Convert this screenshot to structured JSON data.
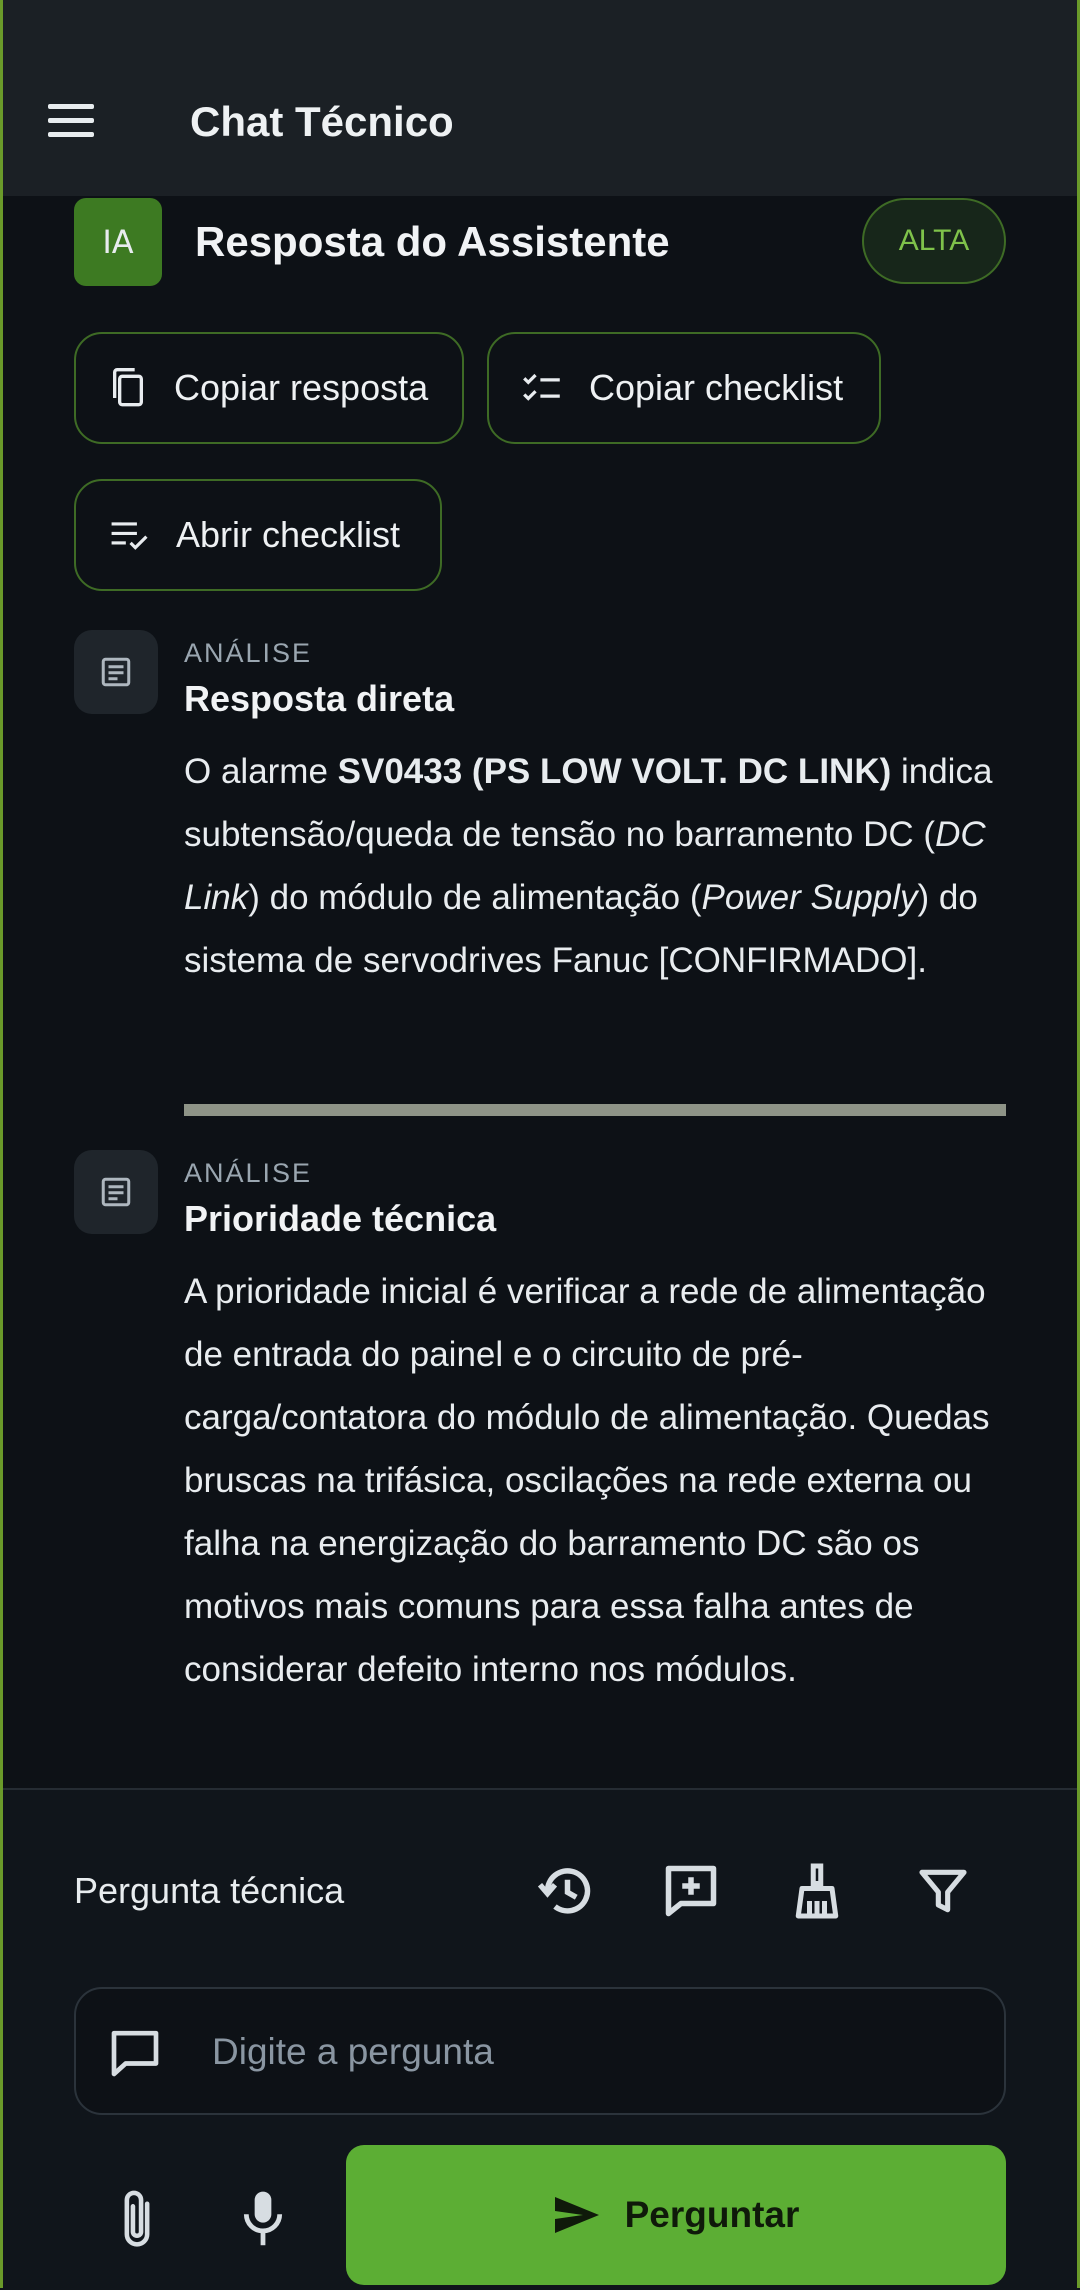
{
  "app_bar": {
    "title": "Chat Técnico",
    "menu_icon": "menu-icon"
  },
  "response": {
    "avatar": "IA",
    "title": "Resposta do Assistente",
    "priority_badge": "ALTA",
    "accent_color": "#5cae34"
  },
  "actions": {
    "copy_response": "Copiar resposta",
    "copy_checklist": "Copiar checklist",
    "open_checklist": "Abrir checklist"
  },
  "sections": [
    {
      "kicker": "ANÁLISE",
      "heading": "Resposta direta",
      "body_parts": {
        "p1": "O alarme ",
        "code": "SV0433 (PS LOW VOLT. DC LINK)",
        "p2": " indica subtensão/queda de tensão no barramento DC (",
        "term1": "DC Link",
        "p3": ") do módulo de alimentação (",
        "term2": "Power Supply",
        "p4": ") do sistema de servodrives Fanuc [CONFIRMADO]."
      }
    },
    {
      "kicker": "ANÁLISE",
      "heading": "Prioridade técnica",
      "body": "A prioridade inicial é verificar a rede de alimentação de entrada do painel e o circuito de pré-carga/contatora do módulo de alimentação. Quedas bruscas na trifásica, oscilações na rede externa ou falha na energização do barramento DC são os motivos mais comuns para essa falha antes de considerar defeito interno nos módulos."
    }
  ],
  "composer": {
    "label": "Pergunta técnica",
    "placeholder": "Digite a pergunta",
    "send_label": "Perguntar"
  }
}
